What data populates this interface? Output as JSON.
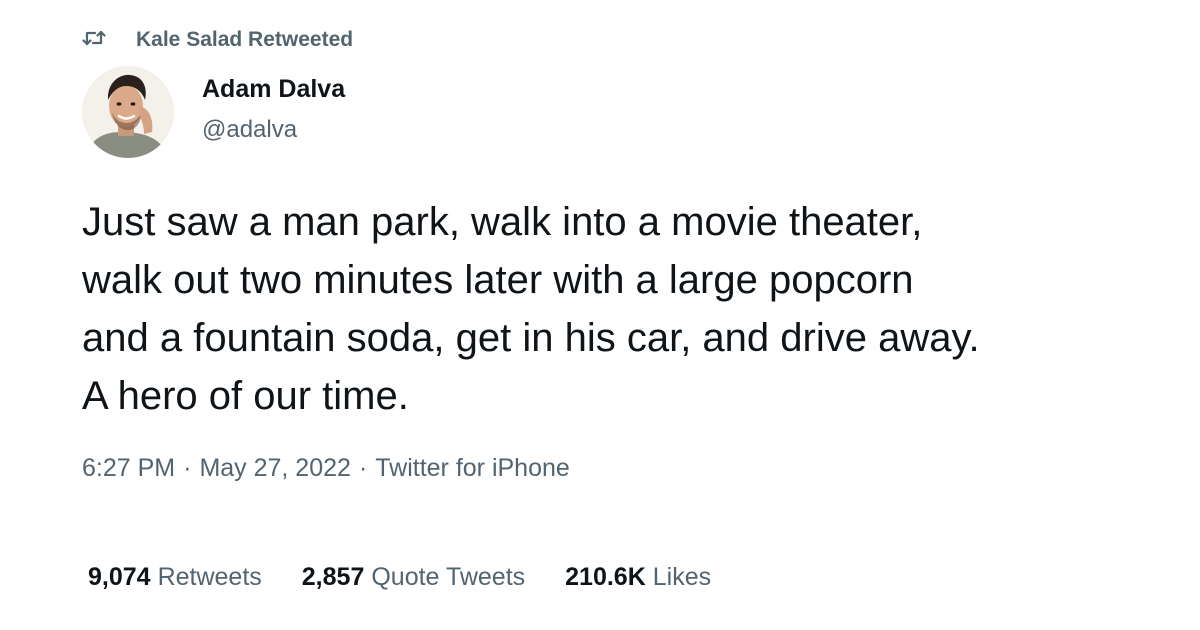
{
  "social_context": {
    "icon": "retweet-icon",
    "label": "Kale Salad Retweeted"
  },
  "author": {
    "avatar": "profile-photo",
    "display_name": "Adam Dalva",
    "handle": "@adalva"
  },
  "tweet": {
    "text": "Just saw a man park, walk into a movie theater,\nwalk out two minutes later with a large popcorn\nand a fountain soda, get in his car, and drive away.\nA hero of our time."
  },
  "meta": {
    "time": "6:27 PM",
    "separator": "·",
    "date": "May 27, 2022",
    "source": "Twitter for iPhone"
  },
  "stats": [
    {
      "count": "9,074",
      "label": "Retweets"
    },
    {
      "count": "2,857",
      "label": "Quote Tweets"
    },
    {
      "count": "210.6K",
      "label": "Likes"
    }
  ],
  "colors": {
    "primary_text": "#0f1419",
    "secondary_text": "#536471",
    "background": "#ffffff"
  }
}
